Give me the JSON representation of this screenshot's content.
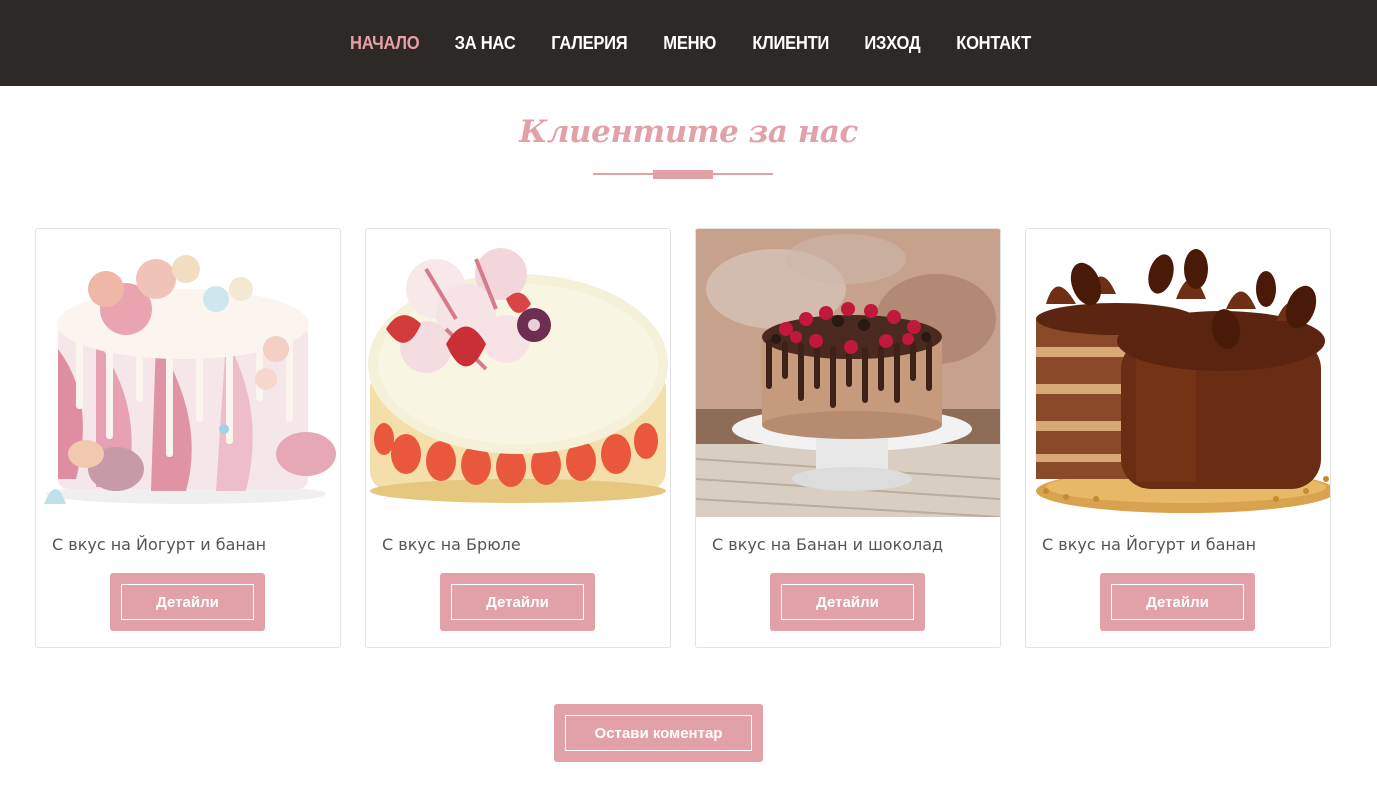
{
  "nav": {
    "items": [
      {
        "label": "НАЧАЛО",
        "active": true
      },
      {
        "label": "ЗА НАС",
        "active": false
      },
      {
        "label": "ГАЛЕРИЯ",
        "active": false
      },
      {
        "label": "МЕНЮ",
        "active": false
      },
      {
        "label": "КЛИЕНТИ",
        "active": false
      },
      {
        "label": "ИЗХОД",
        "active": false
      },
      {
        "label": "КОНТАКТ",
        "active": false
      }
    ]
  },
  "section": {
    "title": "Клиентите за нас"
  },
  "cards": [
    {
      "caption": "С вкус на Йогурт и банан",
      "button_label": "Детайли",
      "image": "pink-drip-cake-with-macarons"
    },
    {
      "caption": "С вкус на Брюле",
      "button_label": "Детайли",
      "image": "white-cake-with-strawberries"
    },
    {
      "caption": "С вкус на Банан и шоколад",
      "button_label": "Детайли",
      "image": "chocolate-drip-cake-with-berries"
    },
    {
      "caption": "С вкус на Йогурт и банан",
      "button_label": "Детайли",
      "image": "sliced-chocolate-cake"
    }
  ],
  "comment_button": {
    "label": "Остави коментар"
  },
  "colors": {
    "nav_background": "#2d2926",
    "accent_pink": "#e2a1a7",
    "nav_active": "#e8a0a8",
    "caption_text": "#555555"
  }
}
